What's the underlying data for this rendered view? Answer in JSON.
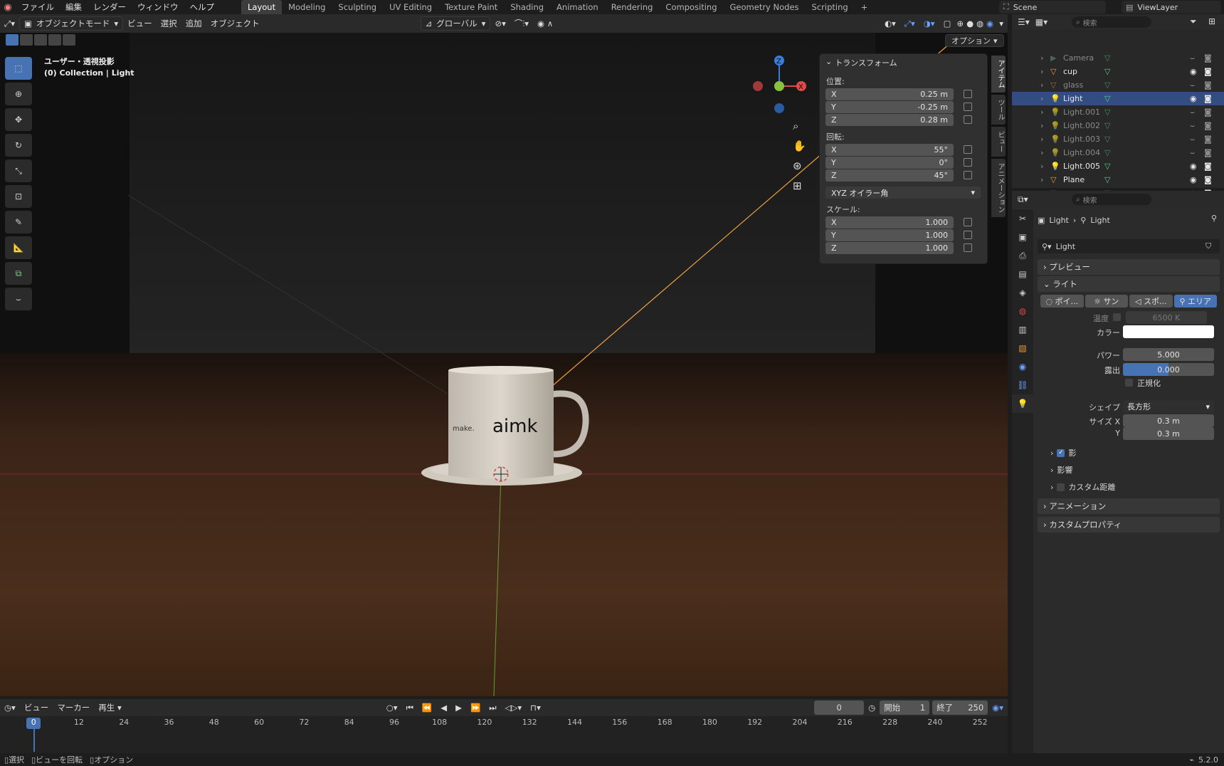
{
  "topbar": {
    "menus": [
      "ファイル",
      "編集",
      "レンダー",
      "ウィンドウ",
      "ヘルプ"
    ],
    "workspaces": [
      "Layout",
      "Modeling",
      "Sculpting",
      "UV Editing",
      "Texture Paint",
      "Shading",
      "Animation",
      "Rendering",
      "Compositing",
      "Geometry Nodes",
      "Scripting"
    ],
    "active_workspace": "Layout",
    "scene": "Scene",
    "view_layer": "ViewLayer"
  },
  "viewport_header": {
    "mode": "オブジェクトモード",
    "menus": [
      "ビュー",
      "選択",
      "追加",
      "オブジェクト"
    ],
    "orientation": "グローバル",
    "options": "オプション"
  },
  "viewport": {
    "view_name": "ユーザー・透視投影",
    "collection_info": "(0) Collection | Light",
    "mug_text": "aimk",
    "mug_small_text": "make."
  },
  "npanel": {
    "title": "トランスフォーム",
    "location_label": "位置:",
    "location": [
      {
        "axis": "X",
        "value": "0.25 m"
      },
      {
        "axis": "Y",
        "value": "-0.25 m"
      },
      {
        "axis": "Z",
        "value": "0.28 m"
      }
    ],
    "rotation_label": "回転:",
    "rotation": [
      {
        "axis": "X",
        "value": "55°"
      },
      {
        "axis": "Y",
        "value": "0°"
      },
      {
        "axis": "Z",
        "value": "45°"
      }
    ],
    "rotation_mode": "XYZ オイラー角",
    "scale_label": "スケール:",
    "scale": [
      {
        "axis": "X",
        "value": "1.000"
      },
      {
        "axis": "Y",
        "value": "1.000"
      },
      {
        "axis": "Z",
        "value": "1.000"
      }
    ],
    "tabs": [
      "アイテム",
      "ツール",
      "ビュー",
      "アニメーション"
    ]
  },
  "outliner": {
    "search_placeholder": "検索",
    "items": [
      {
        "name": "Camera",
        "kind": "camera",
        "visible": false
      },
      {
        "name": "cup",
        "kind": "mesh",
        "visible": true
      },
      {
        "name": "glass",
        "kind": "mesh",
        "visible": false
      },
      {
        "name": "Light",
        "kind": "light",
        "visible": true,
        "selected": true
      },
      {
        "name": "Light.001",
        "kind": "light",
        "visible": false
      },
      {
        "name": "Light.002",
        "kind": "light",
        "visible": false
      },
      {
        "name": "Light.003",
        "kind": "light",
        "visible": false
      },
      {
        "name": "Light.004",
        "kind": "light",
        "visible": false
      },
      {
        "name": "Light.005",
        "kind": "light",
        "visible": true
      },
      {
        "name": "Plane",
        "kind": "mesh",
        "visible": true
      },
      {
        "name": "saucer",
        "kind": "mesh",
        "visible": true
      }
    ]
  },
  "properties": {
    "search_placeholder": "検索",
    "breadcrumb_object": "Light",
    "breadcrumb_data": "Light",
    "datablock_name": "Light",
    "preview_label": "プレビュー",
    "light_label": "ライト",
    "light_types": [
      "ポイ...",
      "サン",
      "スポ...",
      "エリア"
    ],
    "active_light_type": "エリア",
    "temperature_label": "温度",
    "temperature_value": "6500 K",
    "color_label": "カラー",
    "color_hex": "#ffffff",
    "power_label": "パワー",
    "power_value": "5.000",
    "exposure_label": "露出",
    "exposure_value": "0.000",
    "normalize_label": "正規化",
    "shape_label": "シェイプ",
    "shape_value": "長方形",
    "size_x_label": "サイズ X",
    "size_x_value": "0.3 m",
    "size_y_label": "Y",
    "size_y_value": "0.3 m",
    "shadow_label": "影",
    "influence_label": "影響",
    "custom_distance_label": "カスタム距離",
    "animation_label": "アニメーション",
    "custom_props_label": "カスタムプロパティ"
  },
  "timeline": {
    "menus": [
      "ビュー",
      "マーカー",
      "再生"
    ],
    "current_frame": "0",
    "start_label": "開始",
    "start_value": "1",
    "end_label": "終了",
    "end_value": "250",
    "ruler": [
      "0",
      "12",
      "24",
      "36",
      "48",
      "60",
      "72",
      "84",
      "96",
      "108",
      "120",
      "132",
      "144",
      "156",
      "168",
      "180",
      "192",
      "204",
      "216",
      "228",
      "240",
      "252"
    ]
  },
  "statusbar": {
    "select": "選択",
    "rotate_view": "ビューを回転",
    "options": "オプション",
    "version": "5.2.0"
  },
  "colors": {
    "accent": "#4772b3",
    "selected_row": "#334d80",
    "light_line": "#f0a040"
  }
}
